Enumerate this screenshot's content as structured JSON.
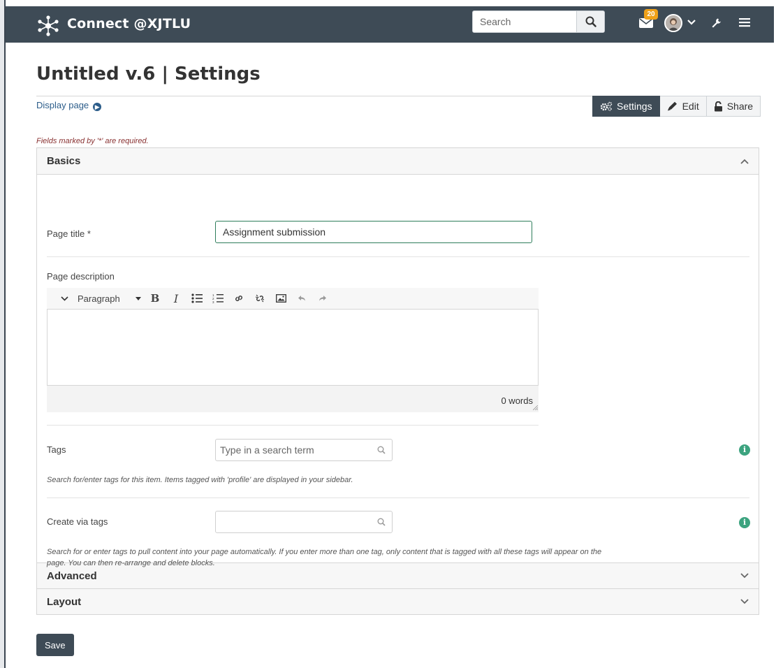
{
  "header": {
    "brand": "Connect @XJTLU",
    "search_placeholder": "Search",
    "inbox_badge": "20",
    "icons": [
      "xjtlu-logo-icon",
      "search-icon",
      "mail-icon",
      "user-avatar",
      "chevron-down-icon",
      "wrench-icon",
      "hamburger-menu-icon"
    ]
  },
  "page": {
    "title": "Untitled v.6 | Settings",
    "display_link": "Display page",
    "tabs": [
      {
        "label": "Settings",
        "icon": "gears-icon",
        "active": true
      },
      {
        "label": "Edit",
        "icon": "pencil-icon",
        "active": false
      },
      {
        "label": "Share",
        "icon": "unlock-icon",
        "active": false
      }
    ],
    "required_note": "Fields marked by '*' are required."
  },
  "basics": {
    "heading": "Basics",
    "page_title_label": "Page title *",
    "page_title_value": "Assignment submission",
    "page_description_label": "Page description",
    "editor": {
      "format": "Paragraph",
      "word_count": "0 words"
    },
    "tags_label": "Tags",
    "tags_placeholder": "Type in a search term",
    "tags_help": "Search for/enter tags for this item. Items tagged with 'profile' are displayed in your sidebar.",
    "create_via_tags_label": "Create via tags",
    "create_via_tags_placeholder": "",
    "create_via_tags_help": "Search for or enter tags to pull content into your page automatically. If you enter more than one tag, only content that is tagged with all these tags will appear on the page. You can then re-arrange and delete blocks."
  },
  "sections": {
    "advanced": "Advanced",
    "layout": "Layout"
  },
  "save_label": "Save",
  "colors": {
    "header_bg": "#3e4b56",
    "badge": "#f0a119",
    "info": "#3ca37f",
    "link": "#2c5d8a",
    "required": "#8a3333"
  }
}
